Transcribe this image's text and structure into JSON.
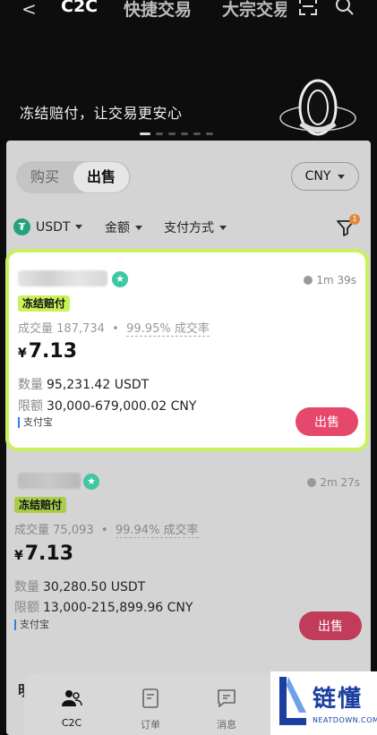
{
  "topbar": {
    "tabs": [
      {
        "label": "C2C",
        "active": true
      },
      {
        "label": "快捷交易",
        "active": false
      },
      {
        "label": "大宗交易",
        "active": false
      }
    ],
    "icons": [
      "back-icon",
      "scan-icon",
      "search-icon"
    ]
  },
  "banner": {
    "text": "冻结赔付，让交易更安心",
    "page_indicator": {
      "count": 6,
      "active": 1
    }
  },
  "segment": {
    "buy_label": "购买",
    "sell_label": "出售",
    "selected": "出售"
  },
  "currency": {
    "label": "CNY"
  },
  "filters": {
    "asset": "USDT",
    "amount": "金额",
    "payment": "支付方式",
    "badge_count": "1"
  },
  "ads": [
    {
      "timer": "1m 39s",
      "tag": "冻结赔付",
      "volume_label": "成交量",
      "volume": "187,734",
      "completion_rate": "99.95% 成交率",
      "currency_symbol": "¥",
      "price": "7.13",
      "qty_label": "数量",
      "qty": "95,231.42 USDT",
      "limit_label": "限额",
      "limit": "30,000-679,000.02 CNY",
      "payment": "支付宝",
      "action": "出售"
    },
    {
      "timer": "2m 27s",
      "tag": "冻结赔付",
      "volume_label": "成交量",
      "volume": "75,093",
      "completion_rate": "99.94% 成交率",
      "currency_symbol": "¥",
      "price": "7.13",
      "qty_label": "数量",
      "qty": "30,280.50 USDT",
      "limit_label": "限额",
      "limit": "13,000-215,899.96 CNY",
      "payment": "支付宝",
      "action": "出售"
    }
  ],
  "peek_text": "明",
  "bottom_nav": [
    {
      "label": "C2C",
      "icon": "user-group-icon",
      "active": true
    },
    {
      "label": "订单",
      "icon": "order-icon",
      "active": false
    },
    {
      "label": "消息",
      "icon": "message-icon",
      "active": false
    }
  ],
  "watermark": {
    "zh": "链懂",
    "en": "NEATDOWN.COM"
  },
  "colors": {
    "highlight": "#c9f25a",
    "sell_button": "#e5486b",
    "verified": "#3fc7a4",
    "usdt": "#26a17b"
  }
}
